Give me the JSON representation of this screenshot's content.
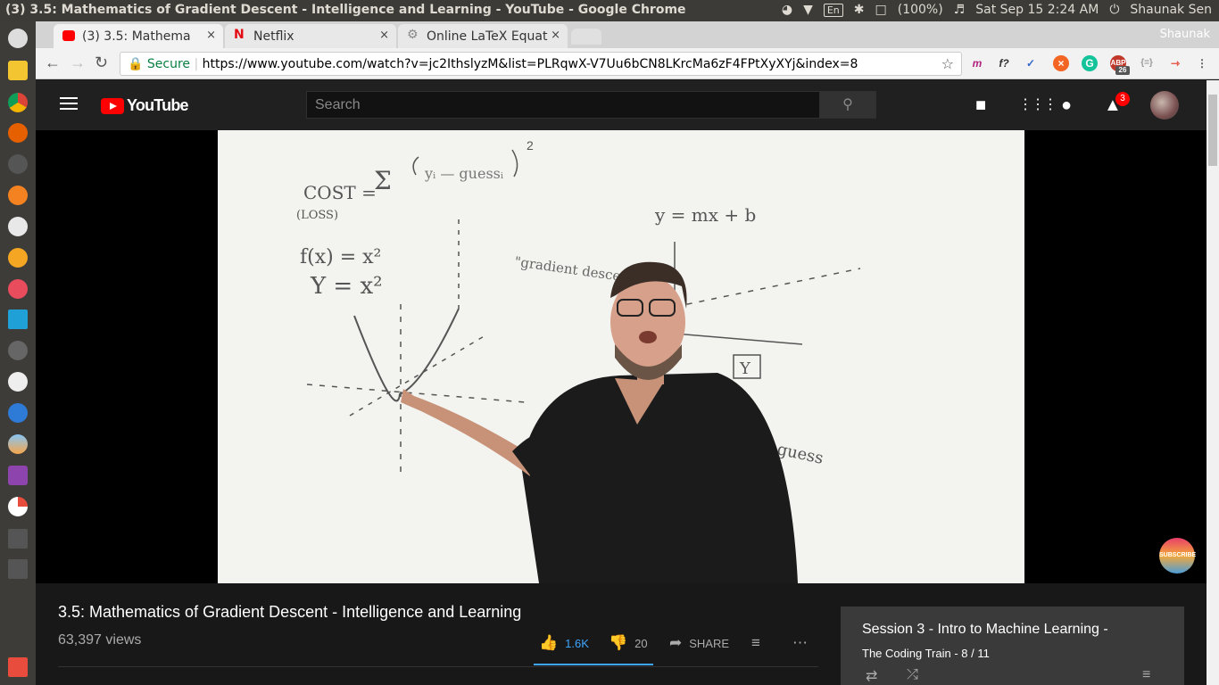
{
  "os_bar": {
    "window_title": "(3) 3.5: Mathematics of Gradient Descent - Intelligence and Learning - YouTube - Google Chrome",
    "keyboard": "En",
    "battery": "(100%)",
    "datetime": "Sat Sep 15  2:24 AM",
    "user": "Shaunak Sen"
  },
  "browser": {
    "tabs": [
      {
        "label": "(3) 3.5: Mathema"
      },
      {
        "label": "Netflix"
      },
      {
        "label": "Online LaTeX Equat"
      }
    ],
    "profile_name": "Shaunak",
    "secure_label": "Secure",
    "url": "https://www.youtube.com/watch?v=jc2IthslyzM&list=PLRqwX-V7Uu6bCN8LKrcMa6zF4FPtXyXYj&index=8",
    "ext_badge": "26"
  },
  "youtube": {
    "logo_text": "YouTube",
    "search_placeholder": "Search",
    "notification_count": "3",
    "subscribe_watermark": "SUBSCRIBE"
  },
  "video": {
    "title": "3.5: Mathematics of Gradient Descent - Intelligence and Learning",
    "views": "63,397 views",
    "likes": "1.6K",
    "dislikes": "20",
    "share_label": "SHARE"
  },
  "playlist": {
    "title": "Session 3 - Intro to Machine Learning -",
    "subtitle": "The Coding Train - 8 / 11"
  },
  "whiteboard": {
    "texts": [
      "COST =",
      "(LOSS)",
      "f(x) = x²",
      "Y = x²",
      "\"gradient descent\"",
      "y = mx + b",
      "Y",
      "guess"
    ]
  }
}
